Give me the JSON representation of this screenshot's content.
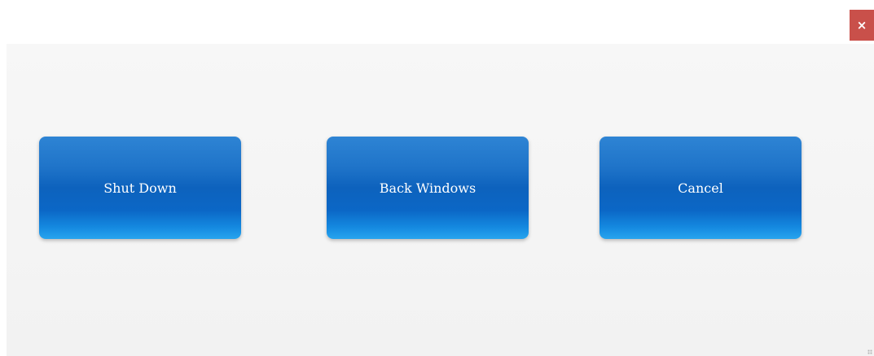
{
  "window": {
    "close_icon": "close-icon",
    "close_glyph": "×",
    "close_color": "#c9504a"
  },
  "buttons": {
    "shutdown_label": "Shut Down",
    "back_label": "Back Windows",
    "cancel_label": "Cancel"
  },
  "colors": {
    "button_blue": "#0d62bd",
    "button_blue_light": "#27a4ee",
    "panel_bg": "#f4f4f4"
  }
}
